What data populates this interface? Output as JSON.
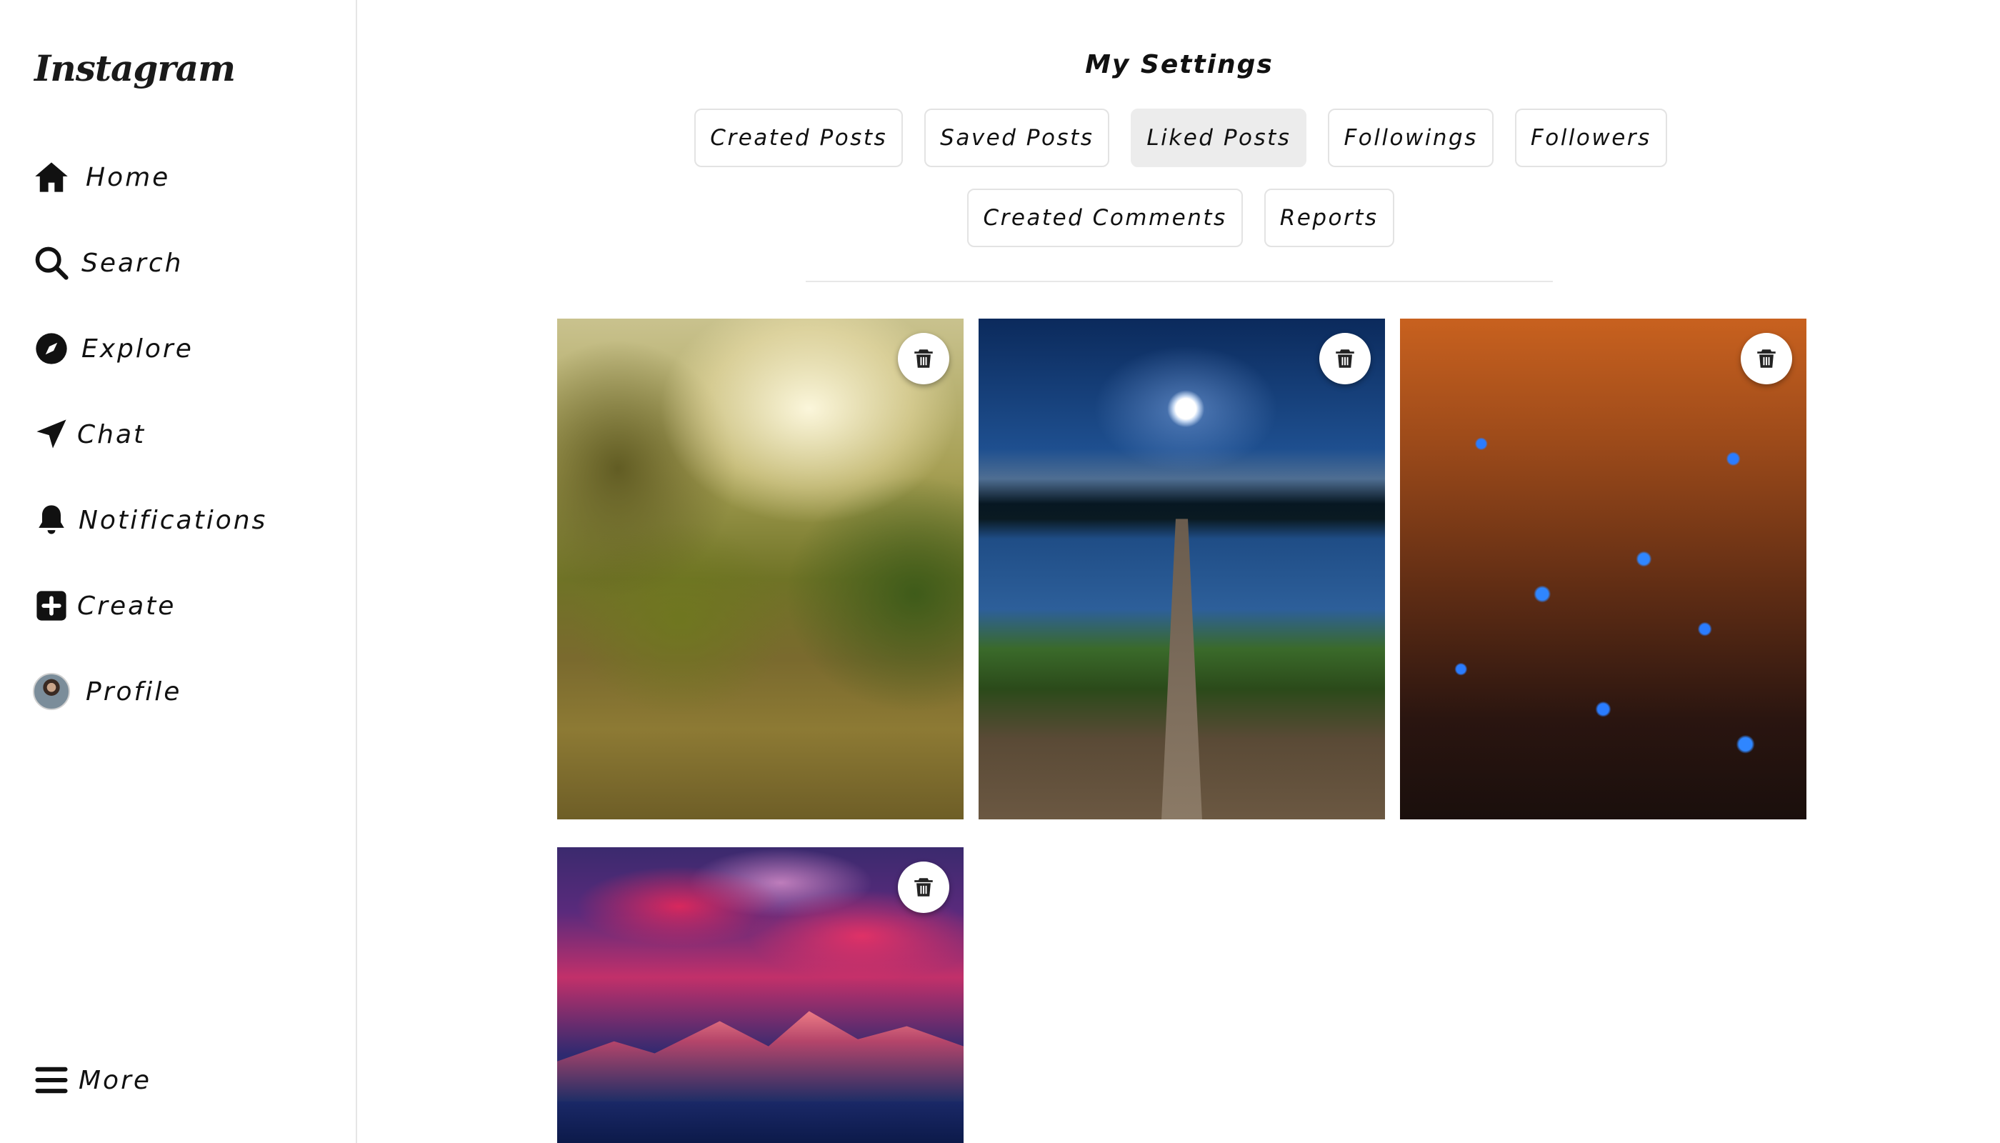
{
  "app": {
    "logo_text": "Instagram"
  },
  "sidebar": {
    "items": [
      {
        "label": "Home",
        "icon": "home-icon"
      },
      {
        "label": "Search",
        "icon": "search-icon"
      },
      {
        "label": "Explore",
        "icon": "compass-icon"
      },
      {
        "label": "Chat",
        "icon": "send-icon"
      },
      {
        "label": "Notifications",
        "icon": "bell-icon"
      },
      {
        "label": "Create",
        "icon": "plus-square-icon"
      },
      {
        "label": "Profile",
        "icon": "avatar"
      }
    ],
    "more": {
      "label": "More",
      "icon": "hamburger-icon"
    }
  },
  "main": {
    "title": "My Settings",
    "tabs": [
      {
        "label": "Created Posts",
        "active": false
      },
      {
        "label": "Saved Posts",
        "active": false
      },
      {
        "label": "Liked Posts",
        "active": true
      },
      {
        "label": "Followings",
        "active": false
      },
      {
        "label": "Followers",
        "active": false
      },
      {
        "label": "Created Comments",
        "active": false
      },
      {
        "label": "Reports",
        "active": false
      }
    ],
    "posts": [
      {
        "image": "sunlit-forest",
        "action_icon": "trash-icon"
      },
      {
        "image": "lake-pier-night",
        "action_icon": "trash-icon"
      },
      {
        "image": "blue-flowers",
        "action_icon": "trash-icon"
      },
      {
        "image": "sunset-mountains",
        "action_icon": "trash-icon"
      }
    ]
  },
  "colors": {
    "background": "#ffffff",
    "text": "#111111",
    "active_tab": "#ececec",
    "border": "#e3e3e3"
  }
}
